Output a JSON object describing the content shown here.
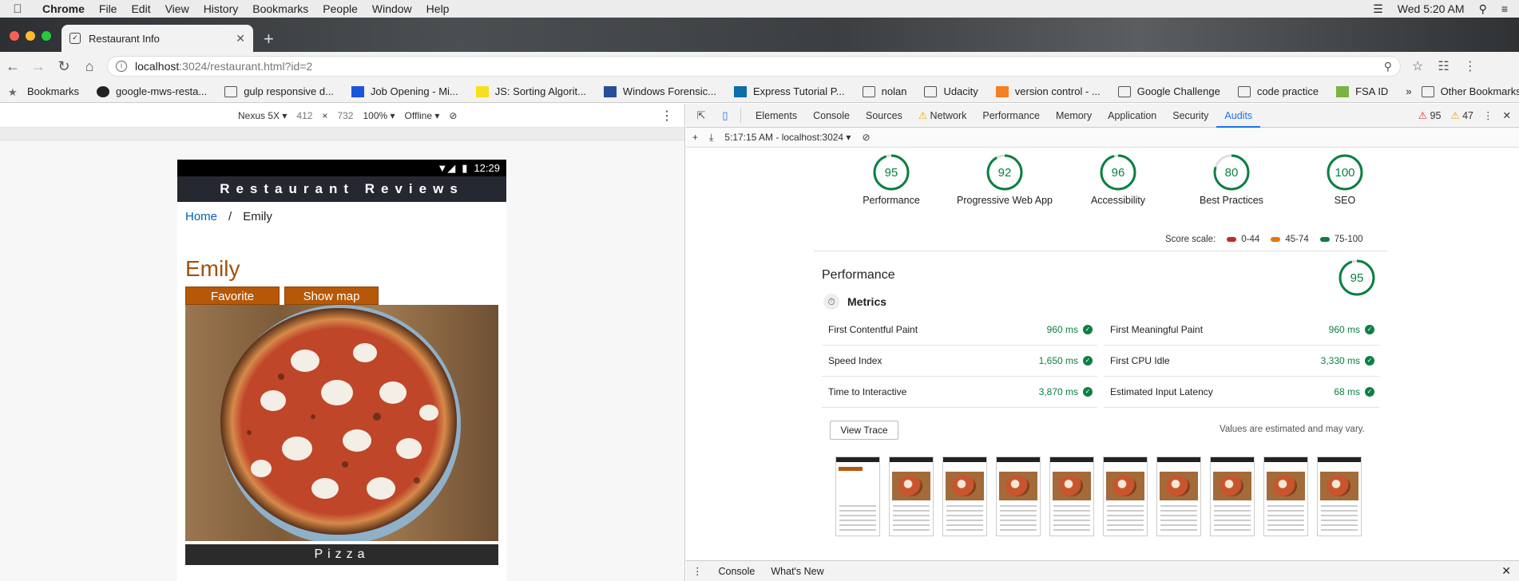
{
  "menubar": {
    "items": [
      "Chrome",
      "File",
      "Edit",
      "View",
      "History",
      "Bookmarks",
      "People",
      "Window",
      "Help"
    ],
    "clock": "Wed 5:20 AM"
  },
  "tab": {
    "title": "Restaurant Info"
  },
  "omnibox": {
    "host": "localhost",
    "path": ":3024/restaurant.html?id=2"
  },
  "bookmarks": {
    "items": [
      {
        "label": "Bookmarks",
        "icon": "star-icon"
      },
      {
        "label": "google-mws-resta...",
        "icon": "github-icon"
      },
      {
        "label": "gulp responsive d...",
        "icon": "folder-icon"
      },
      {
        "label": "Job Opening - Mi...",
        "icon": "site-icon"
      },
      {
        "label": "JS: Sorting Algorit...",
        "icon": "js-icon"
      },
      {
        "label": "Windows Forensic...",
        "icon": "site-icon"
      },
      {
        "label": "Express Tutorial P...",
        "icon": "site-icon"
      },
      {
        "label": "nolan",
        "icon": "folder-icon"
      },
      {
        "label": "Udacity",
        "icon": "folder-icon"
      },
      {
        "label": "version control - ...",
        "icon": "site-icon"
      },
      {
        "label": "Google Challenge",
        "icon": "folder-icon"
      },
      {
        "label": "code practice",
        "icon": "folder-icon"
      },
      {
        "label": "FSA ID",
        "icon": "site-icon"
      }
    ],
    "other": "Other Bookmarks"
  },
  "device_toolbar": {
    "device": "Nexus 5X",
    "width": "412",
    "height": "732",
    "zoom": "100%",
    "network": "Offline"
  },
  "phone": {
    "time": "12:29",
    "site_title": "Restaurant Reviews",
    "breadcrumb_home": "Home",
    "breadcrumb_sep": "/",
    "breadcrumb_current": "Emily",
    "restaurant_name": "Emily",
    "favorite_label": "Favorite",
    "showmap_label": "Show map",
    "cuisine": "Pizza"
  },
  "devtools": {
    "tabs": [
      "Elements",
      "Console",
      "Sources",
      "Network",
      "Performance",
      "Memory",
      "Application",
      "Security",
      "Audits"
    ],
    "active_tab": "Audits",
    "error_count": "95",
    "warning_count": "47",
    "audit_run": "5:17:15 AM - localhost:3024",
    "gauges": [
      {
        "score": 95,
        "label": "Performance"
      },
      {
        "score": 92,
        "label": "Progressive Web App"
      },
      {
        "score": 96,
        "label": "Accessibility"
      },
      {
        "score": 80,
        "label": "Best Practices"
      },
      {
        "score": 100,
        "label": "SEO"
      }
    ],
    "scale_label": "Score scale:",
    "scale": [
      {
        "range": "0-44",
        "color": "#c62828"
      },
      {
        "range": "45-74",
        "color": "#e67700"
      },
      {
        "range": "75-100",
        "color": "#0b8043"
      }
    ],
    "perf_title": "Performance",
    "perf_score": 95,
    "metrics_title": "Metrics",
    "metrics": [
      {
        "name": "First Contentful Paint",
        "value": "960 ms"
      },
      {
        "name": "First Meaningful Paint",
        "value": "960 ms"
      },
      {
        "name": "Speed Index",
        "value": "1,650 ms"
      },
      {
        "name": "First CPU Idle",
        "value": "3,330 ms"
      },
      {
        "name": "Time to Interactive",
        "value": "3,870 ms"
      },
      {
        "name": "Estimated Input Latency",
        "value": "68 ms"
      }
    ],
    "view_trace": "View Trace",
    "estimate_note": "Values are estimated and may vary.",
    "drawer_tabs": [
      "Console",
      "What's New"
    ]
  },
  "colors": {
    "pass": "#0b8043",
    "orange": "#b65808",
    "link": "#0060b6"
  }
}
